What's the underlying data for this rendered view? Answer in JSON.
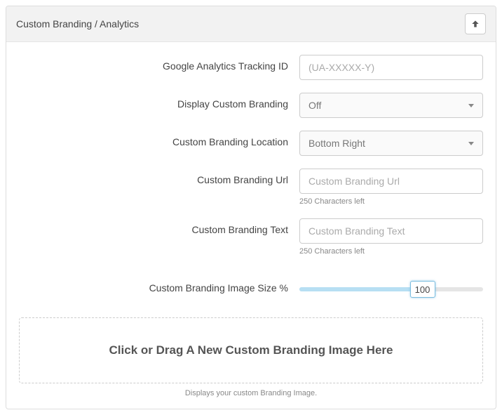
{
  "panel": {
    "title": "Custom Branding / Analytics"
  },
  "fields": {
    "tracking_id": {
      "label": "Google Analytics Tracking ID",
      "placeholder": "(UA-XXXXX-Y)",
      "value": ""
    },
    "display_custom_branding": {
      "label": "Display Custom Branding",
      "value": "Off"
    },
    "custom_branding_location": {
      "label": "Custom Branding Location",
      "value": "Bottom Right"
    },
    "custom_branding_url": {
      "label": "Custom Branding Url",
      "placeholder": "Custom Branding Url",
      "value": "",
      "helper": "250 Characters left"
    },
    "custom_branding_text": {
      "label": "Custom Branding Text",
      "placeholder": "Custom Branding Text",
      "value": "",
      "helper": "250 Characters left"
    },
    "image_size": {
      "label": "Custom Branding Image Size %",
      "value": "100"
    }
  },
  "dropzone": {
    "text": "Click or Drag A New Custom Branding Image Here",
    "caption": "Displays your custom Branding Image."
  }
}
